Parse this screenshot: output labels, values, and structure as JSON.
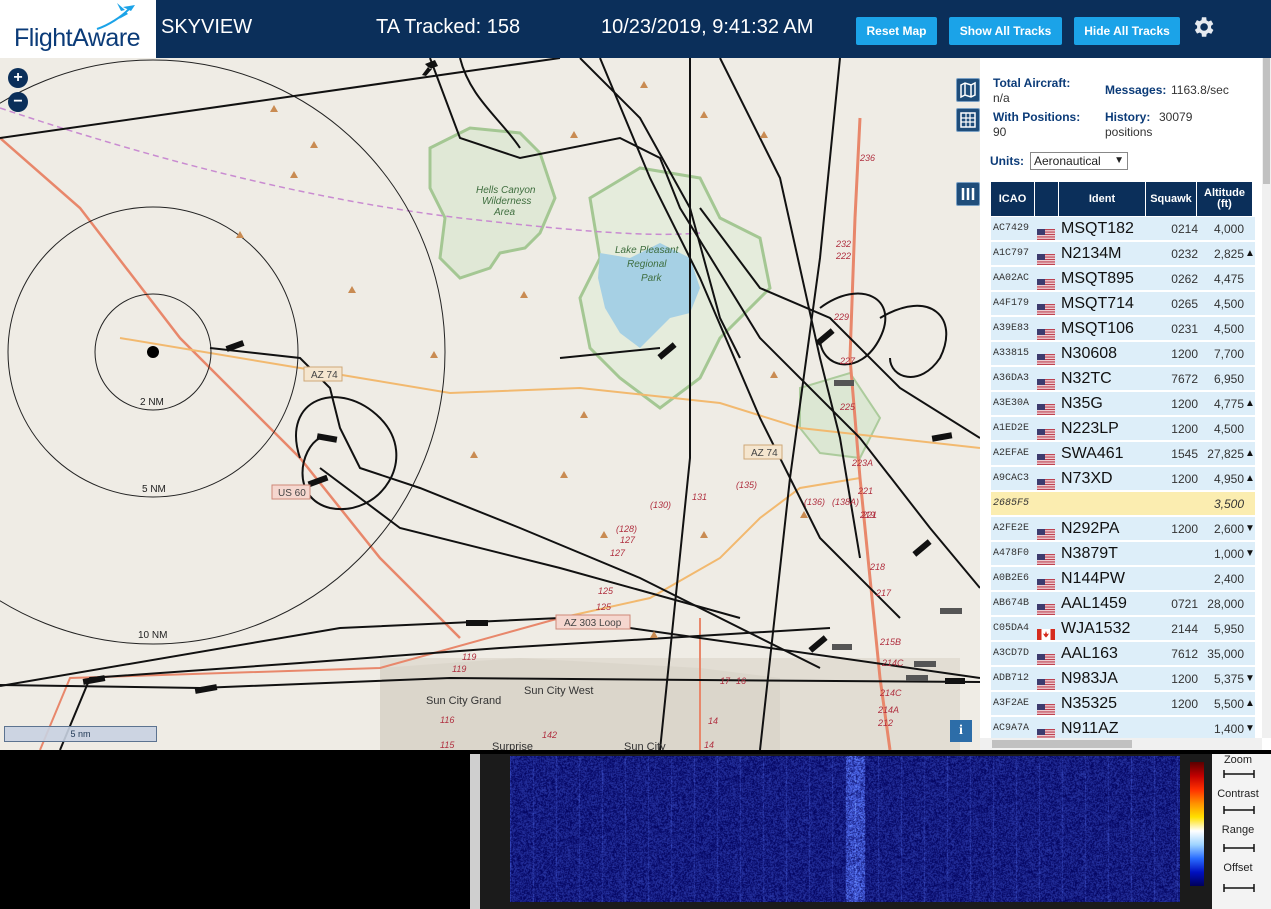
{
  "header": {
    "logo_text": "FlightAware",
    "app_name": "SKYVIEW",
    "ta_tracked": "TA Tracked: 158",
    "datetime": "10/23/2019, 9:41:32 AM",
    "buttons": {
      "reset": "Reset Map",
      "show_all": "Show All Tracks",
      "hide_all": "Hide All Tracks"
    },
    "accent_color": "#1ba3e8",
    "bar_color": "#0b2f5a"
  },
  "map": {
    "zoom_in": "+",
    "zoom_out": "−",
    "scale_label": "5 nm",
    "info": "i",
    "range_rings": [
      "2 NM",
      "5 NM",
      "10 NM"
    ],
    "places": [
      "Hells Canyon Wilderness Area",
      "Lake Pleasant Regional Park",
      "Sun City Grand",
      "Sun City West",
      "Surprise",
      "Sun City"
    ],
    "roads": [
      "AZ 74",
      "US 60",
      "AZ 303 Loop",
      "AZ 74"
    ],
    "road_numbers": [
      "236",
      "232",
      "222",
      "229",
      "227",
      "225",
      "223A",
      "221",
      "219",
      "218",
      "217",
      "215B",
      "214C",
      "214A",
      "214C",
      "212",
      "131",
      "(130)",
      "(135)",
      "(128)",
      "127",
      "127",
      "125",
      "125",
      "119",
      "119",
      "116",
      "115",
      "142",
      "(136)",
      "(138A)",
      "221",
      "17",
      "16",
      "14",
      "14"
    ]
  },
  "stats": {
    "total_aircraft_label": "Total Aircraft:",
    "total_aircraft_value": "n/a",
    "messages_label": "Messages:",
    "messages_value": "1163.8/sec",
    "with_positions_label": "With Positions:",
    "with_positions_value": "90",
    "history_label": "History:",
    "history_value": "30079",
    "history_unit": "positions"
  },
  "units": {
    "label": "Units:",
    "selected": "Aeronautical"
  },
  "table": {
    "headers": {
      "icao": "ICAO",
      "flag": "",
      "ident": "Ident",
      "squawk": "Squawk",
      "alt_line1": "Altitude",
      "alt_line2": "(ft)"
    },
    "rows": [
      {
        "icao": "AC7429",
        "flag": "us",
        "ident": "MSQT182",
        "squawk": "0214",
        "alt": "4,000",
        "trend": ""
      },
      {
        "icao": "A1C797",
        "flag": "us",
        "ident": "N2134M",
        "squawk": "0232",
        "alt": "2,825",
        "trend": "▲"
      },
      {
        "icao": "AA02AC",
        "flag": "us",
        "ident": "MSQT895",
        "squawk": "0262",
        "alt": "4,475",
        "trend": ""
      },
      {
        "icao": "A4F179",
        "flag": "us",
        "ident": "MSQT714",
        "squawk": "0265",
        "alt": "4,500",
        "trend": ""
      },
      {
        "icao": "A39E83",
        "flag": "us",
        "ident": "MSQT106",
        "squawk": "0231",
        "alt": "4,500",
        "trend": ""
      },
      {
        "icao": "A33815",
        "flag": "us",
        "ident": "N30608",
        "squawk": "1200",
        "alt": "7,700",
        "trend": ""
      },
      {
        "icao": "A36DA3",
        "flag": "us",
        "ident": "N32TC",
        "squawk": "7672",
        "alt": "6,950",
        "trend": ""
      },
      {
        "icao": "A3E30A",
        "flag": "us",
        "ident": "N35G",
        "squawk": "1200",
        "alt": "4,775",
        "trend": "▲"
      },
      {
        "icao": "A1ED2E",
        "flag": "us",
        "ident": "N223LP",
        "squawk": "1200",
        "alt": "4,500",
        "trend": ""
      },
      {
        "icao": "A2EFAE",
        "flag": "us",
        "ident": "SWA461",
        "squawk": "1545",
        "alt": "27,825",
        "trend": "▲"
      },
      {
        "icao": "A9CAC3",
        "flag": "us",
        "ident": "N73XD",
        "squawk": "1200",
        "alt": "4,950",
        "trend": "▲"
      },
      {
        "icao": "2685F5",
        "flag": "",
        "ident": "",
        "squawk": "",
        "alt": "3,500",
        "trend": ""
      },
      {
        "icao": "A2FE2E",
        "flag": "us",
        "ident": "N292PA",
        "squawk": "1200",
        "alt": "2,600",
        "trend": "▼"
      },
      {
        "icao": "A478F0",
        "flag": "us",
        "ident": "N3879T",
        "squawk": "",
        "alt": "1,000",
        "trend": "▼"
      },
      {
        "icao": "A0B2E6",
        "flag": "us",
        "ident": "N144PW",
        "squawk": "",
        "alt": "2,400",
        "trend": ""
      },
      {
        "icao": "AB674B",
        "flag": "us",
        "ident": "AAL1459",
        "squawk": "0721",
        "alt": "28,000",
        "trend": ""
      },
      {
        "icao": "C05DA4",
        "flag": "ca",
        "ident": "WJA1532",
        "squawk": "2144",
        "alt": "5,950",
        "trend": ""
      },
      {
        "icao": "A3CD7D",
        "flag": "us",
        "ident": "AAL163",
        "squawk": "7612",
        "alt": "35,000",
        "trend": ""
      },
      {
        "icao": "ADB712",
        "flag": "us",
        "ident": "N983JA",
        "squawk": "1200",
        "alt": "5,375",
        "trend": "▼"
      },
      {
        "icao": "A3F2AE",
        "flag": "us",
        "ident": "N35325",
        "squawk": "1200",
        "alt": "5,500",
        "trend": "▲"
      },
      {
        "icao": "AC9A7A",
        "flag": "us",
        "ident": "N911AZ",
        "squawk": "",
        "alt": "1,400",
        "trend": "▼"
      }
    ]
  },
  "spectrogram": {
    "controls": [
      "Zoom",
      "Contrast",
      "Range",
      "Offset"
    ]
  }
}
